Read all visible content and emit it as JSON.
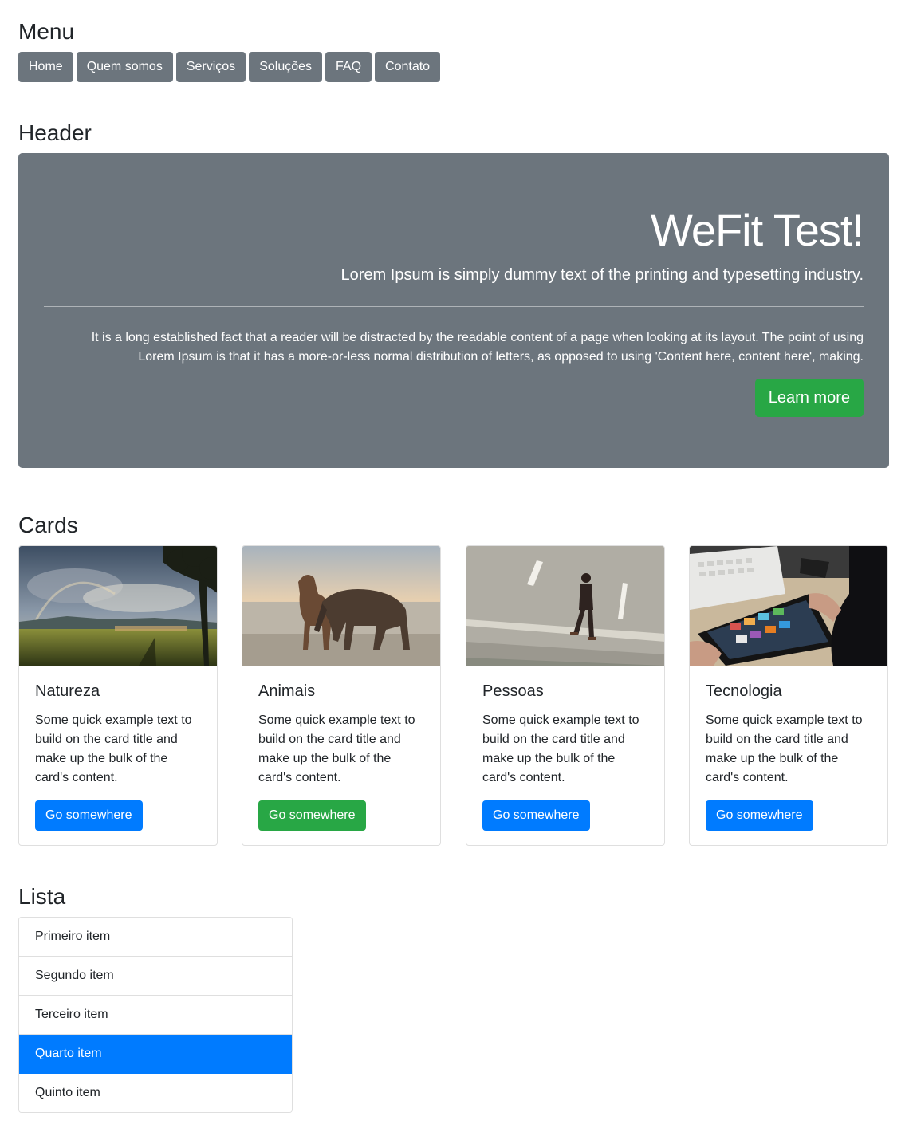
{
  "menu": {
    "title": "Menu",
    "items": [
      "Home",
      "Quem somos",
      "Serviços",
      "Soluções",
      "FAQ",
      "Contato"
    ]
  },
  "header": {
    "section_title": "Header",
    "title": "WeFit Test!",
    "lead": "Lorem Ipsum is simply dummy text of the printing and typesetting industry.",
    "text": "It is a long established fact that a reader will be distracted by the readable content of a page when looking at its layout. The point of using Lorem Ipsum is that it has a more-or-less normal distribution of letters, as opposed to using 'Content here, content here', making.",
    "button": "Learn more",
    "bg_color": "#6c757d",
    "button_color": "#28a745"
  },
  "cards": {
    "section_title": "Cards",
    "items": [
      {
        "title": "Natureza",
        "text": "Some quick example text to build on the card title and make up the bulk of the card's content.",
        "button": "Go somewhere",
        "button_color": "#007bff",
        "image": "landscape-photo"
      },
      {
        "title": "Animais",
        "text": "Some quick example text to build on the card title and make up the bulk of the card's content.",
        "button": "Go somewhere",
        "button_color": "#28a745",
        "image": "horse-photo"
      },
      {
        "title": "Pessoas",
        "text": "Some quick example text to build on the card title and make up the bulk of the card's content.",
        "button": "Go somewhere",
        "button_color": "#007bff",
        "image": "person-road-photo"
      },
      {
        "title": "Tecnologia",
        "text": "Some quick example text to build on the card title and make up the bulk of the card's content.",
        "button": "Go somewhere",
        "button_color": "#007bff",
        "image": "tablet-photo"
      }
    ]
  },
  "list": {
    "section_title": "Lista",
    "items": [
      "Primeiro item",
      "Segundo item",
      "Terceiro item",
      "Quarto item",
      "Quinto item"
    ],
    "active_index": 3,
    "active_color": "#007bff"
  }
}
